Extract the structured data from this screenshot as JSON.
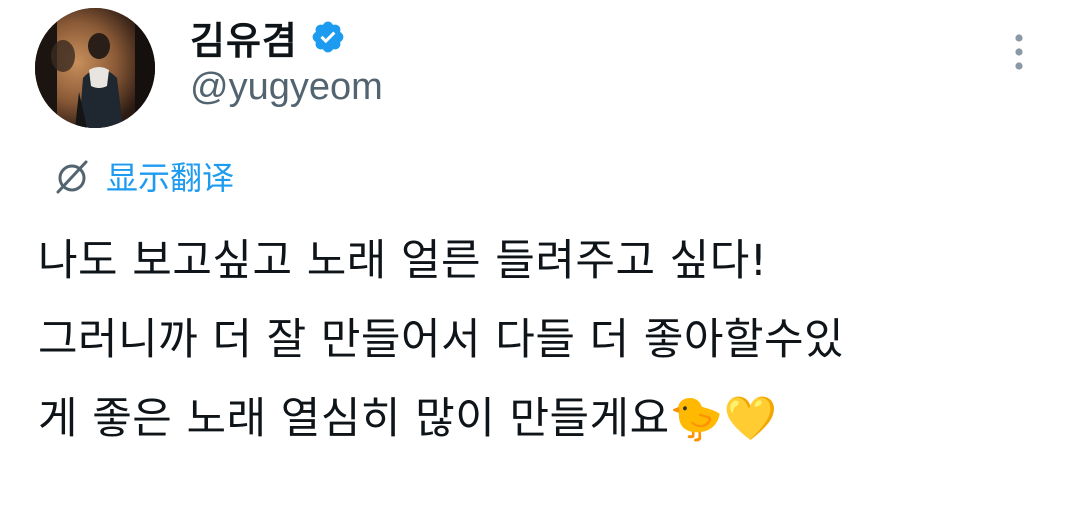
{
  "user": {
    "display_name": "김유겸",
    "handle": "@yugyeom",
    "verified": true
  },
  "translate": {
    "label": "显示翻译"
  },
  "tweet": {
    "lines": [
      "나도 보고싶고 노래 얼른 들려주고 싶다!",
      "그러니까 더 잘 만들어서 다들 더 좋아할수있",
      "게 좋은 노래 열심히 많이 만들게요🐤💛"
    ]
  },
  "colors": {
    "accent": "#1d9bf0",
    "text": "#0f1419",
    "secondary": "#536471"
  },
  "icons": {
    "verified": "verified-badge-icon",
    "more": "more-options-icon",
    "translate": "translate-icon"
  }
}
